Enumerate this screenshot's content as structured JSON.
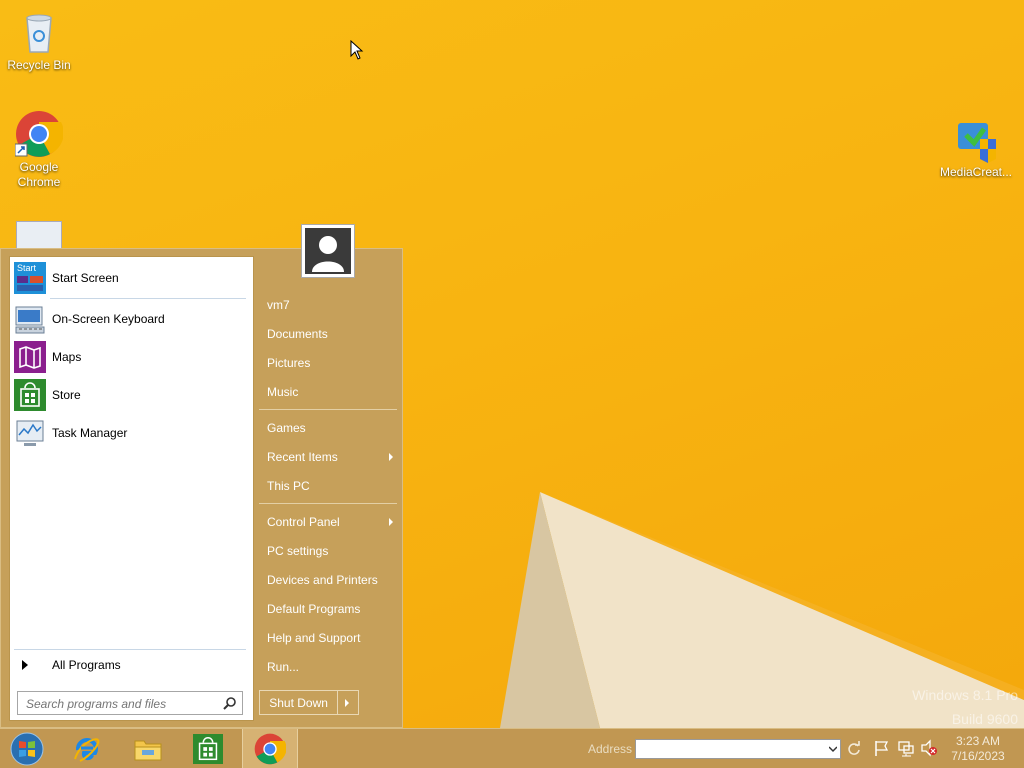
{
  "desktop": {
    "icons": [
      {
        "label": "Recycle Bin",
        "icon": "recycle-bin-icon"
      },
      {
        "label": "Google Chrome",
        "icon": "chrome-icon"
      },
      {
        "label": "MediaCreat...",
        "icon": "media-creation-tool-icon"
      }
    ],
    "watermark": {
      "line1": "Windows 8.1 Pro",
      "line2": "Build 9600"
    }
  },
  "start_menu": {
    "programs": [
      {
        "label": "Start Screen",
        "icon": "start-screen-icon"
      },
      {
        "label": "On-Screen Keyboard",
        "icon": "keyboard-icon"
      },
      {
        "label": "Maps",
        "icon": "maps-icon"
      },
      {
        "label": "Store",
        "icon": "store-icon"
      },
      {
        "label": "Task Manager",
        "icon": "task-manager-icon"
      }
    ],
    "start_screen_badge": "Start",
    "all_programs": "All Programs",
    "search_placeholder": "Search programs and files",
    "right_items": [
      {
        "label": "vm7",
        "submenu": false
      },
      {
        "label": "Documents",
        "submenu": false
      },
      {
        "label": "Pictures",
        "submenu": false
      },
      {
        "label": "Music",
        "submenu": false
      },
      {
        "label": "Games",
        "submenu": false
      },
      {
        "label": "Recent Items",
        "submenu": true
      },
      {
        "label": "This PC",
        "submenu": false
      },
      {
        "label": "Control Panel",
        "submenu": true
      },
      {
        "label": "PC settings",
        "submenu": false
      },
      {
        "label": "Devices and Printers",
        "submenu": false
      },
      {
        "label": "Default Programs",
        "submenu": false
      },
      {
        "label": "Help and Support",
        "submenu": false
      },
      {
        "label": "Run...",
        "submenu": false
      }
    ],
    "shutdown": "Shut Down"
  },
  "taskbar": {
    "pinned": [
      "internet-explorer-icon",
      "file-explorer-icon",
      "store-icon",
      "chrome-icon"
    ],
    "address_label": "Address",
    "address_value": "",
    "clock_time": "3:23 AM",
    "clock_date": "7/16/2023"
  },
  "colors": {
    "wallpaper": "#f8b411",
    "menu_bg": "#c6a05a",
    "taskbar_bg": "#c19752"
  }
}
